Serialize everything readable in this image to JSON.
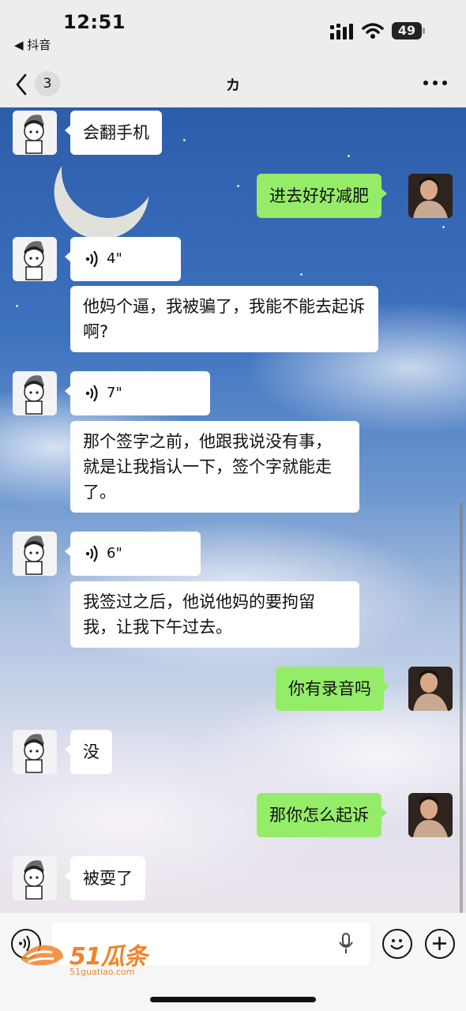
{
  "status_bar": {
    "time": "12:51",
    "back_app": "◀ 抖音",
    "battery": "49"
  },
  "nav": {
    "unread_count": "3",
    "title": "カ"
  },
  "messages": [
    {
      "from": "them",
      "type": "text",
      "text": "会翻手机"
    },
    {
      "from": "me",
      "type": "text",
      "text": "进去好好减肥"
    },
    {
      "from": "them",
      "type": "voice",
      "duration": "4\""
    },
    {
      "from": "them",
      "type": "text",
      "text": "他妈个逼，我被骗了，我能不能去起诉啊?"
    },
    {
      "from": "them",
      "type": "voice",
      "duration": "7\""
    },
    {
      "from": "them",
      "type": "text",
      "text": "那个签字之前，他跟我说没有事，就是让我指认一下，签个字就能走了。"
    },
    {
      "from": "them",
      "type": "voice",
      "duration": "6\""
    },
    {
      "from": "them",
      "type": "text",
      "text": "我签过之后，他说他妈的要拘留我，让我下午过去。"
    },
    {
      "from": "me",
      "type": "text",
      "text": "你有录音吗"
    },
    {
      "from": "them",
      "type": "text",
      "text": "没"
    },
    {
      "from": "me",
      "type": "text",
      "text": "那你怎么起诉"
    },
    {
      "from": "them",
      "type": "text",
      "text": "被耍了"
    }
  ],
  "input_bar": {
    "icons": [
      "voice-icon",
      "microphone-icon",
      "emoji-icon",
      "plus-icon"
    ]
  },
  "watermark": {
    "brand": "51瓜条",
    "url": "51guatiao.com"
  },
  "colors": {
    "my_bubble": "#95ec69",
    "their_bubble": "#ffffff",
    "background": "#ededed",
    "watermark": "#f0842a"
  }
}
